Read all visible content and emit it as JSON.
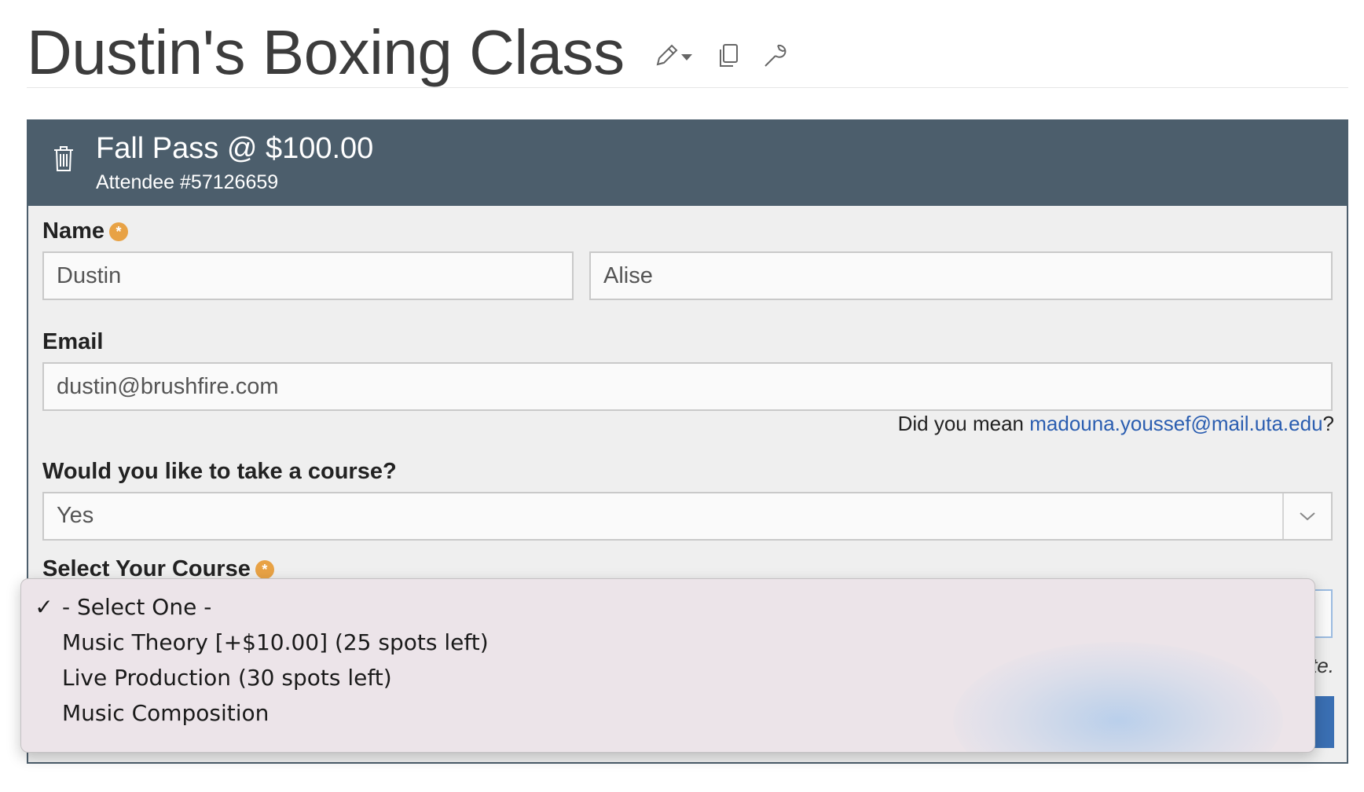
{
  "page": {
    "title": "Dustin's Boxing Class"
  },
  "panel": {
    "pass_title": "Fall Pass @ $100.00",
    "attendee": "Attendee #57126659"
  },
  "form": {
    "name_label": "Name",
    "first_name": "Dustin",
    "last_name": "Alise",
    "email_label": "Email",
    "email": "dustin@brushfire.com",
    "hint_prefix": "Did you mean ",
    "hint_suggestion": "madouna.youssef@mail.uta.edu",
    "hint_suffix": "?",
    "course_question_label": "Would you like to take a course?",
    "course_question_value": "Yes",
    "select_course_label": "Select Your Course",
    "note_fragment": "te.",
    "required_marker": "*"
  },
  "dropdown": {
    "selected_mark": "✓",
    "options": [
      {
        "label": "- Select One -",
        "selected": true
      },
      {
        "label": "Music Theory [+$10.00] (25 spots left)",
        "selected": false
      },
      {
        "label": "Live Production (30 spots left)",
        "selected": false
      },
      {
        "label": "Music Composition",
        "selected": false
      }
    ]
  },
  "colors": {
    "panel_header": "#4c5e6c",
    "required": "#e8a245",
    "link": "#2a5db0",
    "primary_button": "#3a6fb3"
  },
  "icons": {
    "edit": "pencil-icon",
    "copy": "copy-icon",
    "settings": "wrench-icon",
    "delete": "trash-icon",
    "select": "chevron-down-icon"
  }
}
